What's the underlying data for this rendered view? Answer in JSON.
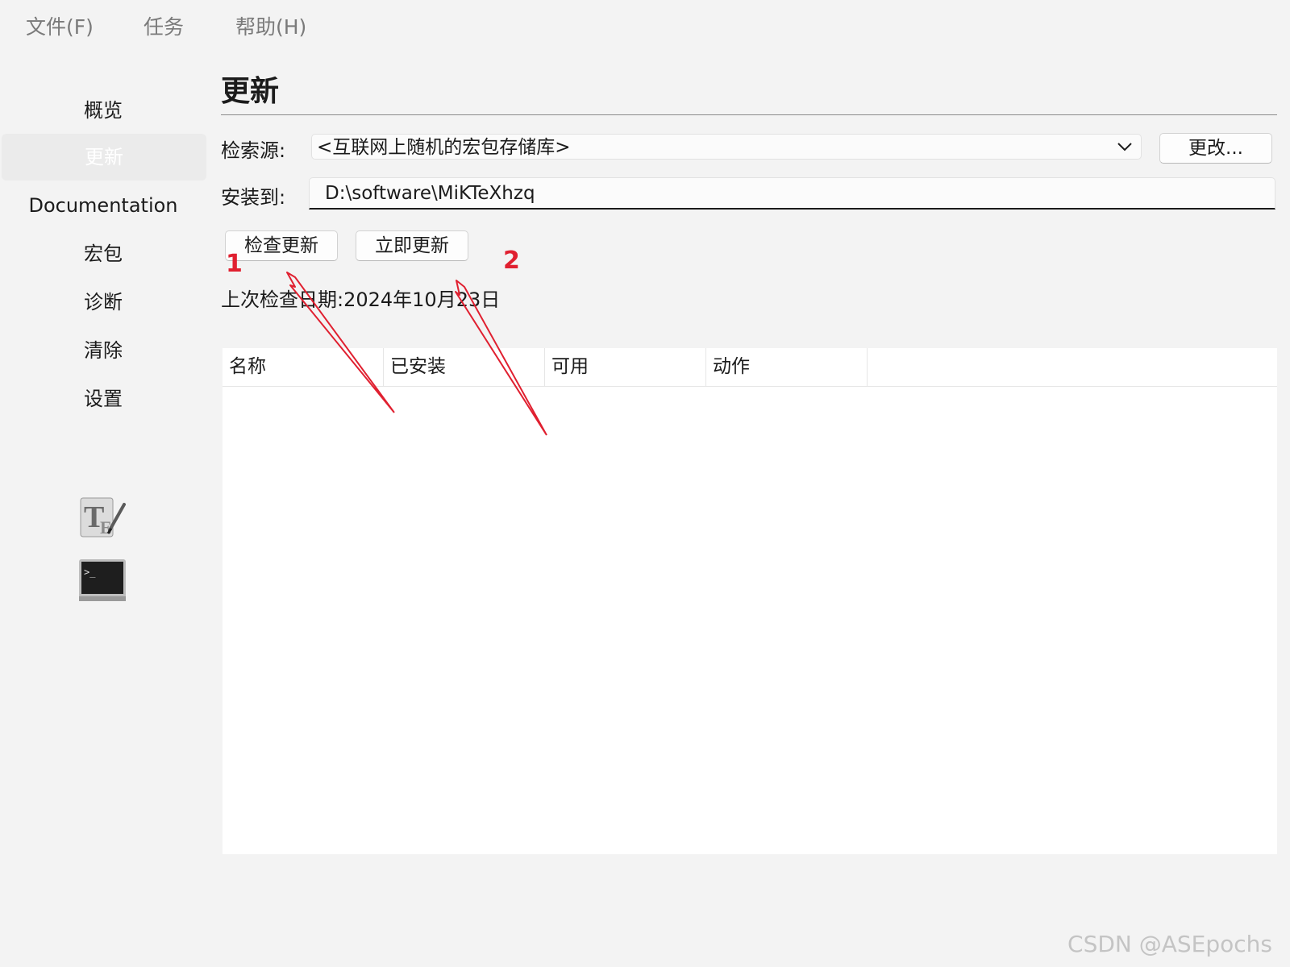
{
  "menu": {
    "file": "文件(F)",
    "tasks": "任务",
    "help": "帮助(H)"
  },
  "sidebar": {
    "items": [
      {
        "label": "概览",
        "selected": false
      },
      {
        "label": "更新",
        "selected": true
      },
      {
        "label": "Documentation",
        "selected": false
      },
      {
        "label": "宏包",
        "selected": false
      },
      {
        "label": "诊断",
        "selected": false
      },
      {
        "label": "清除",
        "selected": false
      },
      {
        "label": "设置",
        "selected": false
      }
    ],
    "tools": [
      {
        "icon": "tex-editor-icon"
      },
      {
        "icon": "terminal-icon"
      }
    ]
  },
  "page": {
    "title": "更新",
    "source_label": "检索源:",
    "source_value": "<互联网上随机的宏包存储库>",
    "change_button": "更改...",
    "install_label": "安装到:",
    "install_path": "D:\\software\\MiKTeXhzq",
    "check_updates_button": "检查更新",
    "update_now_button": "立即更新",
    "last_check": "上次检查日期:2024年10月23日"
  },
  "table": {
    "columns": [
      "名称",
      "已安装",
      "可用",
      "动作"
    ],
    "rows": []
  },
  "annotations": {
    "marker_1": "1",
    "marker_2": "2",
    "color": "#e02030"
  },
  "watermark": "CSDN @ASEpochs"
}
